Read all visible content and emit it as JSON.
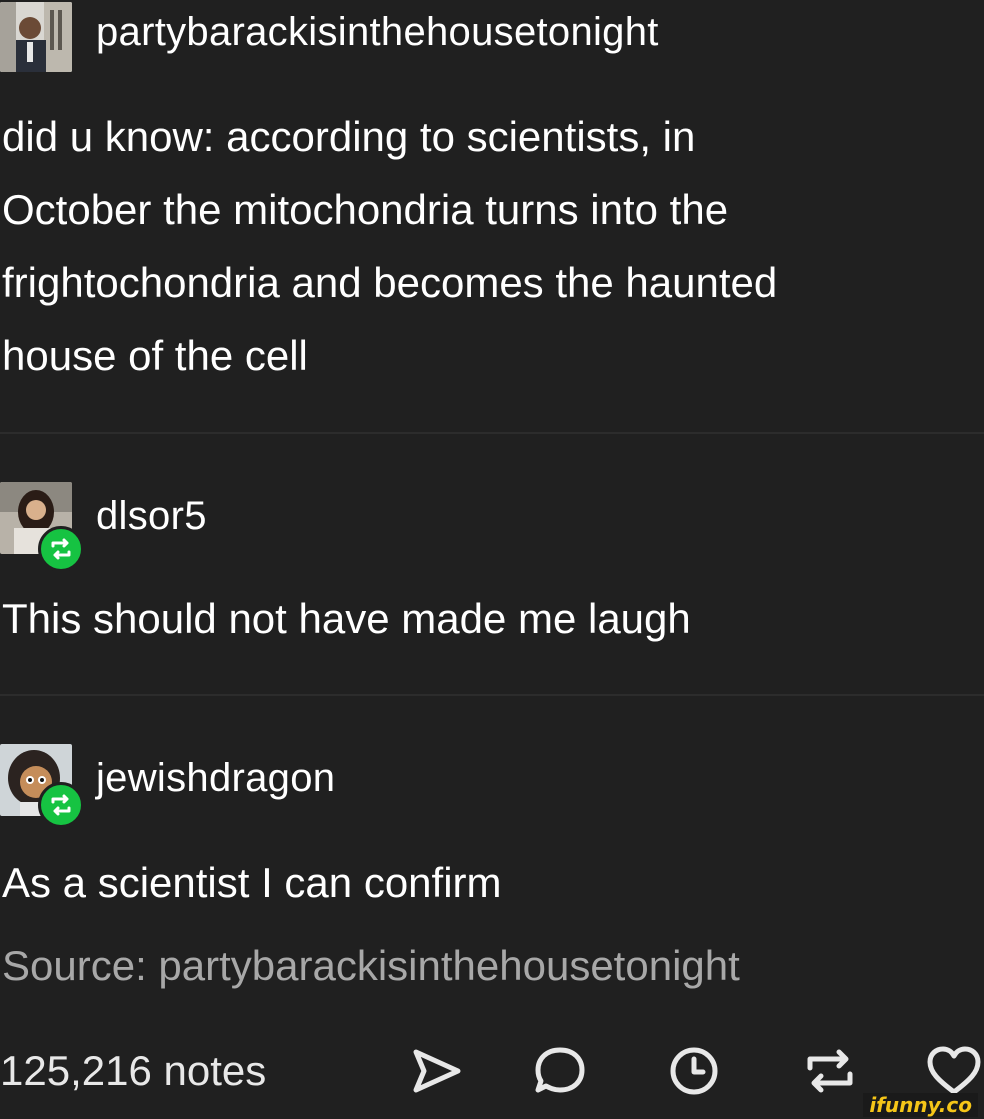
{
  "original_post": {
    "username": "partybarackisinthehousetonight",
    "text_lines": [
      "did u know: according to scientists, in",
      "October the mitochondria turns into the",
      "frightochondria and becomes the haunted",
      "house of the cell"
    ]
  },
  "reblogs": [
    {
      "username": "dlsor5",
      "text": "This should not have made me laugh",
      "badge_icon": "reblog-icon"
    },
    {
      "username": "jewishdragon",
      "text": "As a scientist I can confirm",
      "badge_icon": "reblog-icon"
    }
  ],
  "source": {
    "text": "Source: partybarackisinthehousetonight"
  },
  "footer": {
    "notes": "125,216 notes",
    "actions": [
      "share-icon",
      "reply-icon",
      "schedule-icon",
      "reblog-icon",
      "like-icon"
    ]
  },
  "watermark": {
    "text": "ifunny.co"
  },
  "colors": {
    "background": "#202020",
    "text": "#ffffff",
    "muted_text": "#a8a8a8",
    "reblog_badge": "#16c342",
    "watermark": "#f5c518"
  }
}
